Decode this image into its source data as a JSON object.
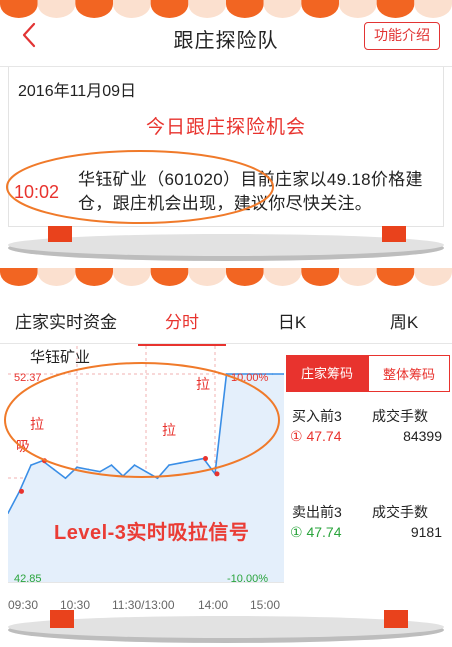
{
  "nav": {
    "title": "跟庄探险队",
    "func_button": "功能介绍"
  },
  "opportunity": {
    "date": "2016年11月09日",
    "headline": "今日跟庄探险机会",
    "time": "10:02",
    "message": "华钰矿业（601020）目前庄家以49.18价格建仓，跟庄机会出现，建议你尽快关注。"
  },
  "tabs": [
    "庄家实时资金",
    "分时",
    "日K",
    "周K"
  ],
  "active_tab": "分时",
  "chart": {
    "stock_name": "华钰矿业",
    "high_price": "52.37",
    "low_price": "42.85",
    "high_pct": "10.00%",
    "low_pct": "-10.00%",
    "time_labels": [
      "09:30",
      "10:30",
      "11:30/13:00",
      "14:00",
      "15:00"
    ],
    "signal_marks": [
      "吸",
      "拉",
      "拉",
      "拉"
    ],
    "overlay_caption": "Level-3实时吸拉信号"
  },
  "chart_data": {
    "type": "line",
    "x": [
      "09:30",
      "09:40",
      "09:50",
      "10:00",
      "10:10",
      "10:20",
      "10:30",
      "10:40",
      "10:50",
      "11:00",
      "11:10",
      "11:20",
      "11:30/13:00",
      "13:10",
      "13:20",
      "13:30",
      "13:40",
      "13:50",
      "14:00",
      "14:10",
      "14:20",
      "14:30",
      "14:40",
      "14:50",
      "15:00"
    ],
    "series": [
      {
        "values": [
          46.0,
          47.0,
          48.2,
          48.4,
          48.0,
          47.6,
          48.1,
          48.0,
          47.9,
          48.2,
          47.7,
          48.2,
          47.9,
          47.6,
          48.2,
          48.3,
          48.4,
          48.5,
          47.8,
          52.37,
          52.37,
          52.37,
          52.37,
          52.37,
          52.37
        ]
      }
    ],
    "ylim": [
      42.85,
      52.37
    ],
    "pct_range": [
      "-10.00%",
      "10.00%"
    ]
  },
  "panel": {
    "tab_active": "庄家筹码",
    "tab_other": "整体筹码",
    "buy_label": "买入前3",
    "buy_count_label": "成交手数",
    "buy_price": "① 47.74",
    "buy_count": "84399",
    "sell_label": "卖出前3",
    "sell_count_label": "成交手数",
    "sell_price": "① 47.74",
    "sell_count": "9181"
  },
  "colors": {
    "accent_red": "#e8332e",
    "ellipse_orange": "#f07a2a",
    "line_blue": "#3a8ee6",
    "green": "#2aa43c"
  }
}
